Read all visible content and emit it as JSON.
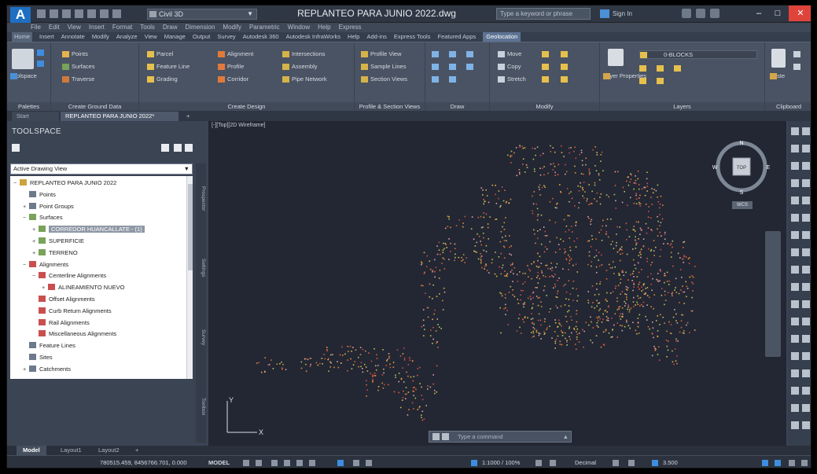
{
  "window": {
    "title": "REPLANTEO PARA JUNIO 2022.dwg",
    "workspace": "Civil 3D",
    "search_placeholder": "Type a keyword or phrase",
    "sign_in": "Sign In",
    "minimize": "–",
    "maximize": "□",
    "close": "✕"
  },
  "menu": [
    "File",
    "Edit",
    "View",
    "Insert",
    "Format",
    "Tools",
    "Draw",
    "Dimension",
    "Modify",
    "Parametric",
    "Window",
    "Help",
    "Express"
  ],
  "ribbon_tabs": [
    {
      "label": "Home"
    },
    {
      "label": "Insert"
    },
    {
      "label": "Annotate"
    },
    {
      "label": "Modify"
    },
    {
      "label": "Analyze"
    },
    {
      "label": "View"
    },
    {
      "label": "Manage"
    },
    {
      "label": "Output"
    },
    {
      "label": "Survey"
    },
    {
      "label": "Autodesk 360"
    },
    {
      "label": "Autodesk InfraWorks"
    },
    {
      "label": "Help"
    },
    {
      "label": "Add-ins"
    },
    {
      "label": "Express Tools"
    },
    {
      "label": "Featured Apps"
    },
    {
      "label": "Geolocation"
    }
  ],
  "ribbon": {
    "palettes": {
      "title": "Palettes",
      "toolspace": "Toolspace"
    },
    "ground": {
      "title": "Create Ground Data",
      "points": "Points",
      "surfaces": "Surfaces",
      "traverse": "Traverse"
    },
    "design": {
      "title": "Create Design",
      "parcel": "Parcel",
      "feature_line": "Feature Line",
      "grading": "Grading",
      "alignment": "Alignment",
      "profile": "Profile",
      "corridor": "Corridor",
      "intersections": "Intersections",
      "assembly": "Assembly",
      "pipe_network": "Pipe Network"
    },
    "profile_views": {
      "title": "Profile & Section Views",
      "profile_view": "Profile View",
      "sample_lines": "Sample Lines",
      "section_views": "Section Views"
    },
    "draw": {
      "title": "Draw"
    },
    "modify": {
      "title": "Modify",
      "move": "Move",
      "copy": "Copy",
      "stretch": "Stretch"
    },
    "layers": {
      "title": "Layers",
      "layer_props": "Layer Properties",
      "current_layer": "0-BLOCKS"
    },
    "clipboard": {
      "title": "Clipboard",
      "paste": "Paste"
    }
  },
  "doc_tabs": {
    "start": "Start",
    "active": "REPLANTEO PARA JUNIO 2022*",
    "new": "+"
  },
  "toolspace": {
    "title": "TOOLSPACE",
    "view_select": "Active Drawing View",
    "tree": [
      {
        "label": "REPLANTEO PARA JUNIO 2022",
        "level": 0,
        "icon": "folder",
        "pm": "−"
      },
      {
        "label": "Points",
        "level": 1,
        "icon": "points",
        "pm": ""
      },
      {
        "label": "Point Groups",
        "level": 1,
        "icon": "points",
        "pm": "+"
      },
      {
        "label": "Surfaces",
        "level": 1,
        "icon": "surface",
        "pm": "−"
      },
      {
        "label": "CORREDOR HUANCALLATE - (1)",
        "level": 2,
        "icon": "surface",
        "pm": "+",
        "selected": true
      },
      {
        "label": "SUPERFICIE",
        "level": 2,
        "icon": "surface",
        "pm": "+"
      },
      {
        "label": "TERRENO",
        "level": 2,
        "icon": "surface",
        "pm": "+"
      },
      {
        "label": "Alignments",
        "level": 1,
        "icon": "align",
        "pm": "−"
      },
      {
        "label": "Centerline Alignments",
        "level": 2,
        "icon": "align",
        "pm": "−"
      },
      {
        "label": "ALINEAMIENTO NUEVO",
        "level": 3,
        "icon": "align",
        "pm": "+"
      },
      {
        "label": "Offset Alignments",
        "level": 2,
        "icon": "align",
        "pm": ""
      },
      {
        "label": "Curb Return Alignments",
        "level": 2,
        "icon": "align",
        "pm": ""
      },
      {
        "label": "Rail Alignments",
        "level": 2,
        "icon": "align",
        "pm": ""
      },
      {
        "label": "Miscellaneous Alignments",
        "level": 2,
        "icon": "align",
        "pm": ""
      },
      {
        "label": "Feature Lines",
        "level": 1,
        "icon": "points",
        "pm": ""
      },
      {
        "label": "Sites",
        "level": 1,
        "icon": "points",
        "pm": ""
      },
      {
        "label": "Catchments",
        "level": 1,
        "icon": "points",
        "pm": "+"
      }
    ],
    "side_tabs": [
      "Prospector",
      "Settings",
      "Survey",
      "Toolbox"
    ]
  },
  "viewport": {
    "label": "[-][Top][2D Wireframe]",
    "viewcube": {
      "top": "TOP",
      "n": "N",
      "s": "S",
      "e": "E",
      "w": "W",
      "wcs": "WCS"
    },
    "ucs": {
      "x": "X",
      "y": "Y"
    },
    "command_placeholder": "Type a command"
  },
  "layout_tabs": {
    "model": "Model",
    "layout1": "Layout1",
    "layout2": "Layout2",
    "add": "+"
  },
  "status": {
    "coords": "780515.459, 8456766.701, 0.000",
    "model": "MODEL",
    "scale": "1:1000 / 100%",
    "units": "Decimal",
    "value": "3.500"
  },
  "colors": {
    "accent": "#3d8ee0",
    "close": "#e0433a",
    "points": "#e0613a"
  }
}
